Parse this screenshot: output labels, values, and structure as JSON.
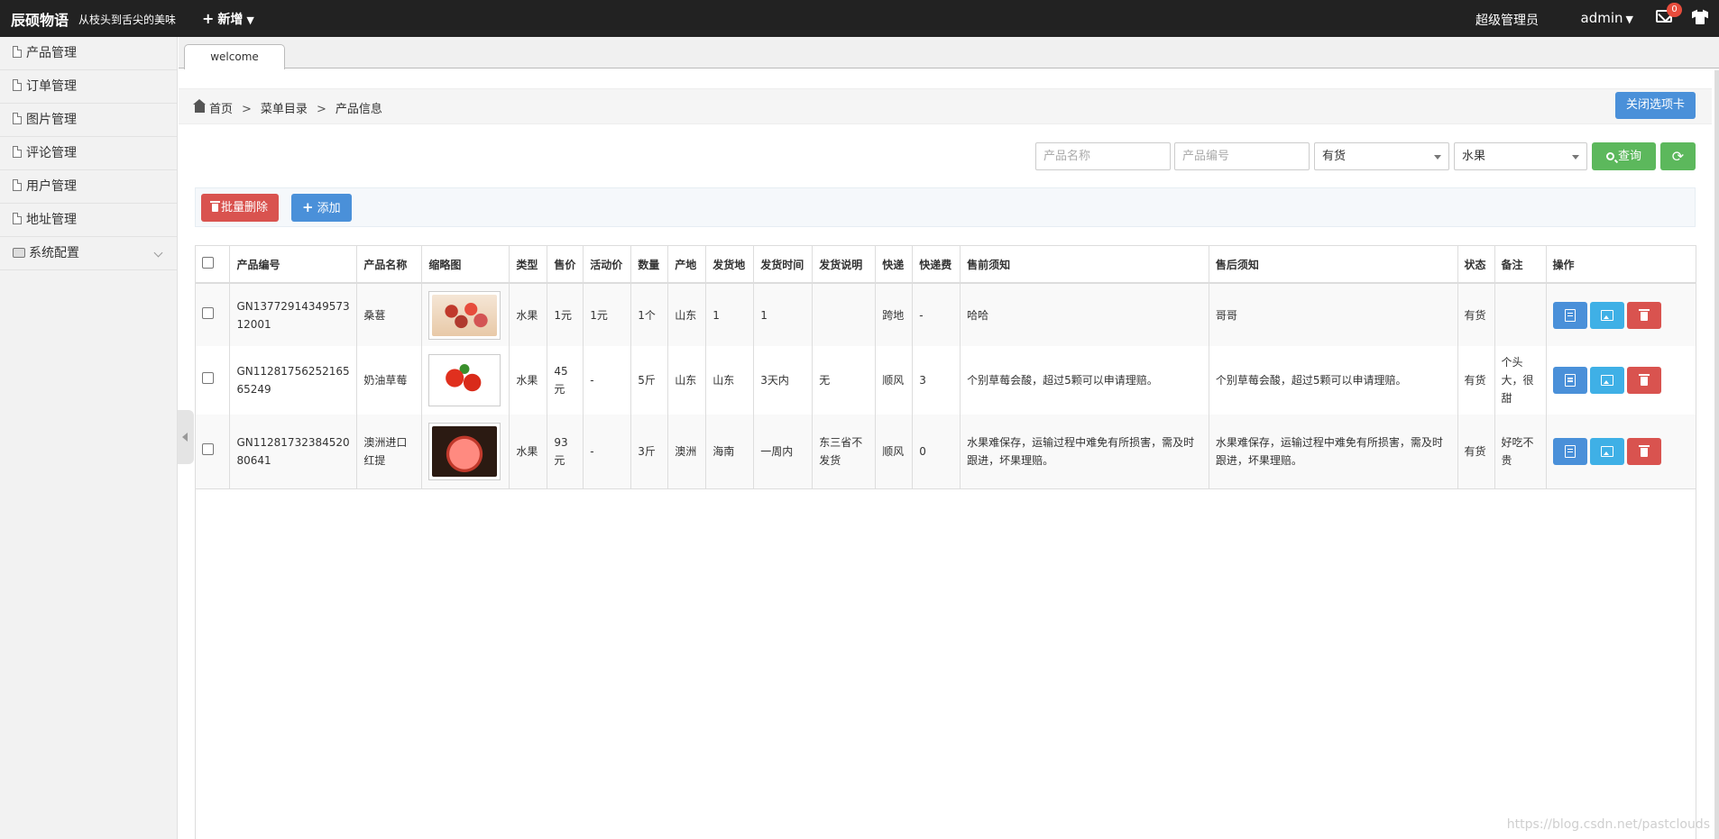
{
  "header": {
    "brand": "辰硕物语",
    "slogan": "从枝头到舌尖的美味",
    "new_menu": "新增",
    "user_role": "超级管理员",
    "user_name": "admin",
    "mail_count": "0"
  },
  "sidebar": {
    "items": [
      {
        "label": "产品管理"
      },
      {
        "label": "订单管理"
      },
      {
        "label": "图片管理"
      },
      {
        "label": "评论管理"
      },
      {
        "label": "用户管理"
      },
      {
        "label": "地址管理"
      },
      {
        "label": "系统配置"
      }
    ]
  },
  "tabs": [
    {
      "label": "welcome"
    }
  ],
  "breadcrumb": {
    "items": [
      "首页",
      "菜单目录",
      "产品信息"
    ],
    "separator": ">",
    "close_tab_label": "关闭选项卡"
  },
  "filters": {
    "name_placeholder": "产品名称",
    "code_placeholder": "产品编号",
    "status_value": "有货",
    "category_value": "水果",
    "query_label": "查询",
    "refresh_label": "⟳"
  },
  "actions": {
    "bulk_delete_label": "批量删除",
    "add_label": "添加"
  },
  "table": {
    "columns": [
      "产品编号",
      "产品名称",
      "缩略图",
      "类型",
      "售价",
      "活动价",
      "数量",
      "产地",
      "发货地",
      "发货时间",
      "发货说明",
      "快递",
      "快递费",
      "售前须知",
      "售后须知",
      "状态",
      "备注",
      "操作"
    ],
    "rows": [
      {
        "code": "GN1377291434957312001",
        "name": "桑葚",
        "thumb": "mulberry",
        "type": "水果",
        "price": "1元",
        "promo": "1元",
        "qty": "1个",
        "origin": "山东",
        "ship_from": "1",
        "ship_time": "1",
        "ship_note": "",
        "express": "跨地",
        "fee": "-",
        "pre_sale": "哈哈",
        "after_sale": "哥哥",
        "status": "有货",
        "remark": ""
      },
      {
        "code": "GN1128175625216565249",
        "name": "奶油草莓",
        "thumb": "strawberry",
        "type": "水果",
        "price": "45元",
        "promo": "-",
        "qty": "5斤",
        "origin": "山东",
        "ship_from": "山东",
        "ship_time": "3天内",
        "ship_note": "无",
        "express": "顺风",
        "fee": "3",
        "pre_sale": "个别草莓会酸，超过5颗可以申请理赔。",
        "after_sale": "个别草莓会酸，超过5颗可以申请理赔。",
        "status": "有货",
        "remark": "个头大，很甜"
      },
      {
        "code": "GN1128173238452080641",
        "name": "澳洲进口红提",
        "thumb": "grape",
        "type": "水果",
        "price": "93元",
        "promo": "-",
        "qty": "3斤",
        "origin": "澳洲",
        "ship_from": "海南",
        "ship_time": "一周内",
        "ship_note": "东三省不发货",
        "express": "顺风",
        "fee": "0",
        "pre_sale": "水果难保存，运输过程中难免有所损害，需及时跟进，坏果理赔。",
        "after_sale": "水果难保存，运输过程中难免有所损害，需及时跟进，坏果理赔。",
        "status": "有货",
        "remark": "好吃不贵"
      }
    ]
  },
  "watermark": "https://blog.csdn.net/pastclouds",
  "colors": {
    "topbar": "#222222",
    "primary": "#4a90d9",
    "success": "#5cb85c",
    "danger": "#d9534f",
    "info": "#3fb0e6"
  }
}
